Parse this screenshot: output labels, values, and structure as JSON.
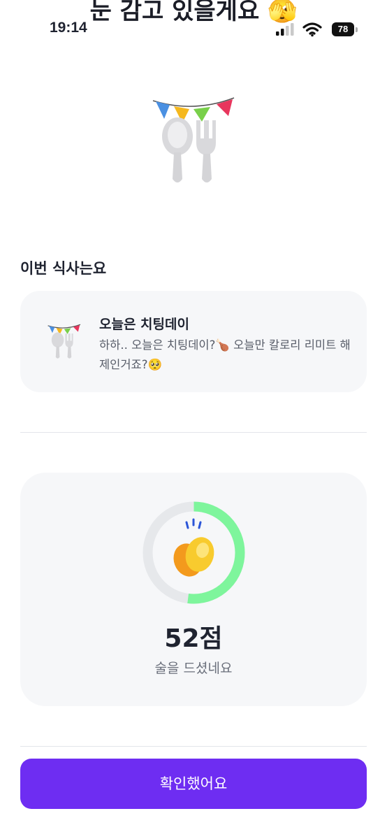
{
  "headline": "눈 감고 있을게요 🫣",
  "status_bar": {
    "time": "19:14",
    "battery_level": "78",
    "icons": [
      "cellular-signal-icon",
      "wifi-icon",
      "battery-icon"
    ]
  },
  "hero": {
    "icon": "party-spoon-fork-icon"
  },
  "meal_section": {
    "title": "이번 식사는요",
    "card": {
      "icon": "party-spoon-fork-icon",
      "title": "오늘은 치팅데이",
      "description": "하하.. 오늘은 치팅데이?🍗 오늘만 칼로리 리미트 해제인거죠?🥺"
    }
  },
  "score": {
    "value_text": "52점",
    "value": 52,
    "gauge_fraction": 0.52,
    "caption": "술을 드셨네요",
    "icon": "clapping-hands-icon",
    "colors": {
      "progress": "#7ef59c",
      "track": "#e6e8eb"
    }
  },
  "confirm_button": {
    "label": "확인했어요"
  },
  "colors": {
    "accent": "#6e2df2",
    "card_background": "#f6f7f9",
    "text_primary": "#1f2330",
    "text_secondary": "#575c68"
  }
}
